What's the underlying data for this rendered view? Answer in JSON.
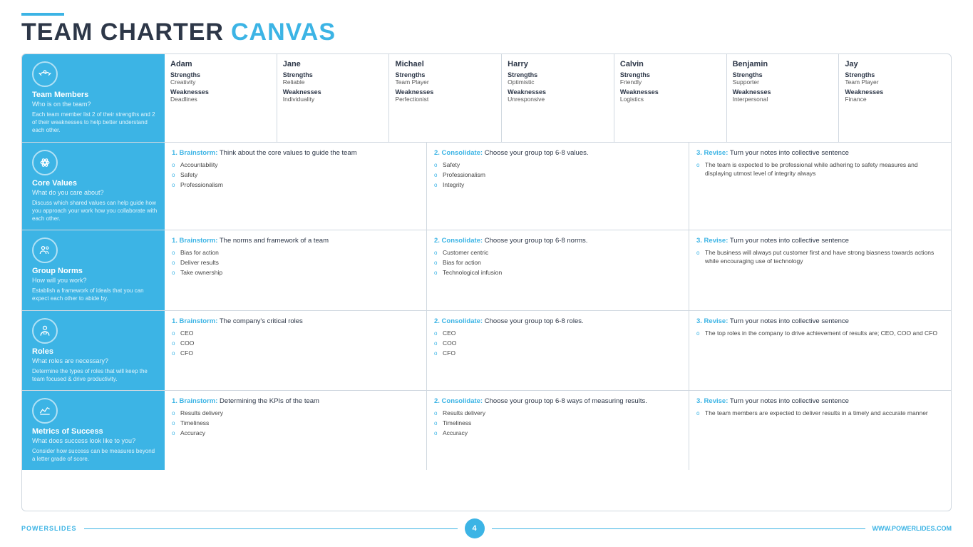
{
  "header": {
    "accent": true,
    "title_dark": "TEAM CHARTER",
    "title_blue": "CANVAS"
  },
  "footer": {
    "brand_power": "POWER",
    "brand_slides": "SLIDES",
    "page_number": "4",
    "website": "WWW.POWERLIDES.COM"
  },
  "rows": [
    {
      "id": "team-members",
      "label": {
        "title": "Team Members",
        "subtitle": "Who is on the team?",
        "desc": "Each team member list 2 of their strengths and 2 of their weaknesses to help better understand each other.",
        "icon": "handshake"
      },
      "members": [
        {
          "name": "Adam",
          "strengths_label": "Strengths",
          "strengths_val": "Creativity",
          "weaknesses_label": "Weaknesses",
          "weaknesses_val": "Deadlines"
        },
        {
          "name": "Jane",
          "strengths_label": "Strengths",
          "strengths_val": "Reliable",
          "weaknesses_label": "Weaknesses",
          "weaknesses_val": "Individuality"
        },
        {
          "name": "Michael",
          "strengths_label": "Strengths",
          "strengths_val": "Team Player",
          "weaknesses_label": "Weaknesses",
          "weaknesses_val": "Perfectionist"
        },
        {
          "name": "Harry",
          "strengths_label": "Strengths",
          "strengths_val": "Optimistic",
          "weaknesses_label": "Weaknesses",
          "weaknesses_val": "Unresponsive"
        },
        {
          "name": "Calvin",
          "strengths_label": "Strengths",
          "strengths_val": "Friendly",
          "weaknesses_label": "Weaknesses",
          "weaknesses_val": "Logistics"
        },
        {
          "name": "Benjamin",
          "strengths_label": "Strengths",
          "strengths_val": "Supporter",
          "weaknesses_label": "Weaknesses",
          "weaknesses_val": "Interpersonal"
        },
        {
          "name": "Jay",
          "strengths_label": "Strengths",
          "strengths_val": "Team Player",
          "weaknesses_label": "Weaknesses",
          "weaknesses_val": "Finance"
        }
      ]
    },
    {
      "id": "core-values",
      "label": {
        "title": "Core Values",
        "subtitle": "What do you care about?",
        "desc": "Discuss which shared values can help guide how you approach your work how you collaborate with each other.",
        "icon": "atom"
      },
      "steps": [
        {
          "step_bold": "1. Brainstorm:",
          "step_text": " Think about the core values to guide the team",
          "bullets": [
            "Accountability",
            "Safety",
            "Professionalism"
          ]
        },
        {
          "step_bold": "2. Consolidate:",
          "step_text": " Choose your group top 6-8 values.",
          "bullets": [
            "Safety",
            "Professionalism",
            "Integrity"
          ]
        },
        {
          "step_bold": "3. Revise:",
          "step_text": " Turn your notes into collective sentence",
          "bullets": [
            "The team is expected to be professional while adhering to safety measures and displaying utmost level of integrity always"
          ]
        }
      ]
    },
    {
      "id": "group-norms",
      "label": {
        "title": "Group Norms",
        "subtitle": "How will you work?",
        "desc": "Establish a framework of ideals that you can expect each other to abide by.",
        "icon": "users"
      },
      "steps": [
        {
          "step_bold": "1. Brainstorm:",
          "step_text": " The norms and framework of a team",
          "bullets": [
            "Bias for action",
            "Deliver results",
            "Take ownership"
          ]
        },
        {
          "step_bold": "2. Consolidate:",
          "step_text": " Choose your group top 6-8 norms.",
          "bullets": [
            "Customer centric",
            "Bias for action",
            "Technological infusion"
          ]
        },
        {
          "step_bold": "3. Revise:",
          "step_text": " Turn your notes into collective sentence",
          "bullets": [
            "The business will always put customer first and have strong biasness towards actions while encouraging use of technology"
          ]
        }
      ]
    },
    {
      "id": "roles",
      "label": {
        "title": "Roles",
        "subtitle": "What roles are necessary?",
        "desc": "Determine the types of roles that will keep the team focused & drive productivity.",
        "icon": "person"
      },
      "steps": [
        {
          "step_bold": "1. Brainstorm:",
          "step_text": " The company's critical roles",
          "bullets": [
            "CEO",
            "COO",
            "CFO"
          ]
        },
        {
          "step_bold": "2. Consolidate:",
          "step_text": " Choose your group top 6-8 roles.",
          "bullets": [
            "CEO",
            "COO",
            "CFO"
          ]
        },
        {
          "step_bold": "3. Revise:",
          "step_text": " Turn your notes into collective sentence",
          "bullets": [
            "The top roles in the company to drive achievement of results are; CEO, COO and CFO"
          ]
        }
      ]
    },
    {
      "id": "metrics",
      "label": {
        "title": "Metrics of Success",
        "subtitle": "What does success look like to you?",
        "desc": "Consider how success can be measures beyond a letter grade of score.",
        "icon": "chart"
      },
      "steps": [
        {
          "step_bold": "1. Brainstorm:",
          "step_text": " Determining the KPIs of the team",
          "bullets": [
            "Results delivery",
            "Timeliness",
            "Accuracy"
          ]
        },
        {
          "step_bold": "2. Consolidate:",
          "step_text": " Choose your group top 6-8 ways of measuring results.",
          "bullets": [
            "Results delivery",
            "Timeliness",
            "Accuracy"
          ]
        },
        {
          "step_bold": "3. Revise:",
          "step_text": " Turn your notes into collective sentence",
          "bullets": [
            "The team members are expected to deliver results in a timely and accurate manner"
          ]
        }
      ]
    }
  ]
}
